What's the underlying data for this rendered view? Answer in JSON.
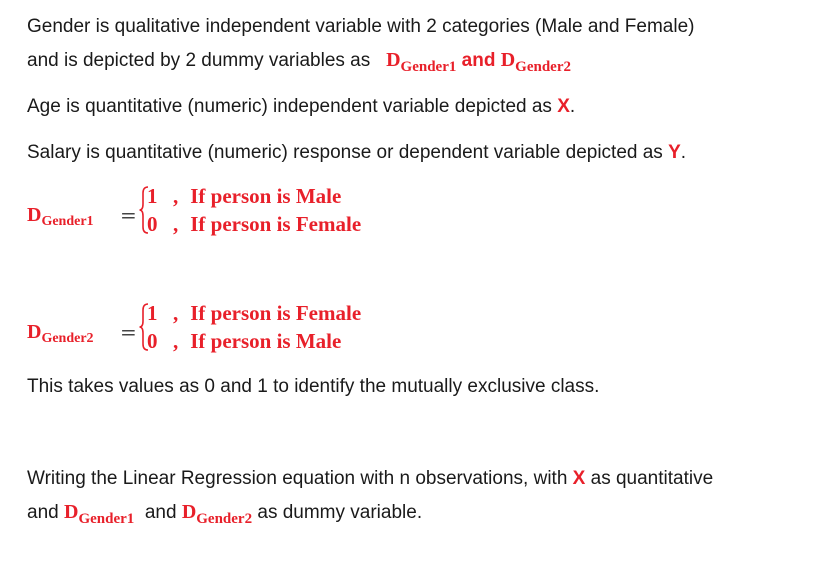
{
  "para1": {
    "line1": "Gender is qualitative independent variable with 2 categories (Male and Female)",
    "line2_prefix": "and is depicted by 2 dummy variables as",
    "d_letter": "D",
    "sub1": "Gender1",
    "and_word": "and",
    "sub2": "Gender2"
  },
  "para2": {
    "text": "Age is quantitative (numeric) independent variable depicted as",
    "var": "X",
    "end": "."
  },
  "para3": {
    "text": "Salary is quantitative (numeric) response or dependent variable depicted as",
    "var": "Y",
    "end": "."
  },
  "eq1": {
    "lhs_letter": "D",
    "lhs_sub": "Gender1",
    "equals": "=",
    "case1_value": "1",
    "case1_text": "If person is Male",
    "case2_value": "0",
    "case2_text": "If person is Female",
    "comma": ","
  },
  "eq2": {
    "lhs_letter": "D",
    "lhs_sub": "Gender2",
    "equals": "=",
    "case1_value": "1",
    "case1_text": "If person is Female",
    "case2_value": "0",
    "case2_text": "If person is Male",
    "comma": ","
  },
  "para4": {
    "text": "This takes values as 0 and 1 to identify the mutually exclusive class."
  },
  "para5": {
    "line1_prefix": "Writing the Linear Regression equation with n observations, with",
    "var": "X",
    "line1_suffix": "as quantitative",
    "line2_and": "and",
    "d_letter": "D",
    "sub1": "Gender1",
    "mid_and": "and",
    "sub2": "Gender2",
    "line2_suffix": "as dummy variable."
  },
  "colors": {
    "accent": "#e8202a",
    "text": "#1a1a1a"
  }
}
